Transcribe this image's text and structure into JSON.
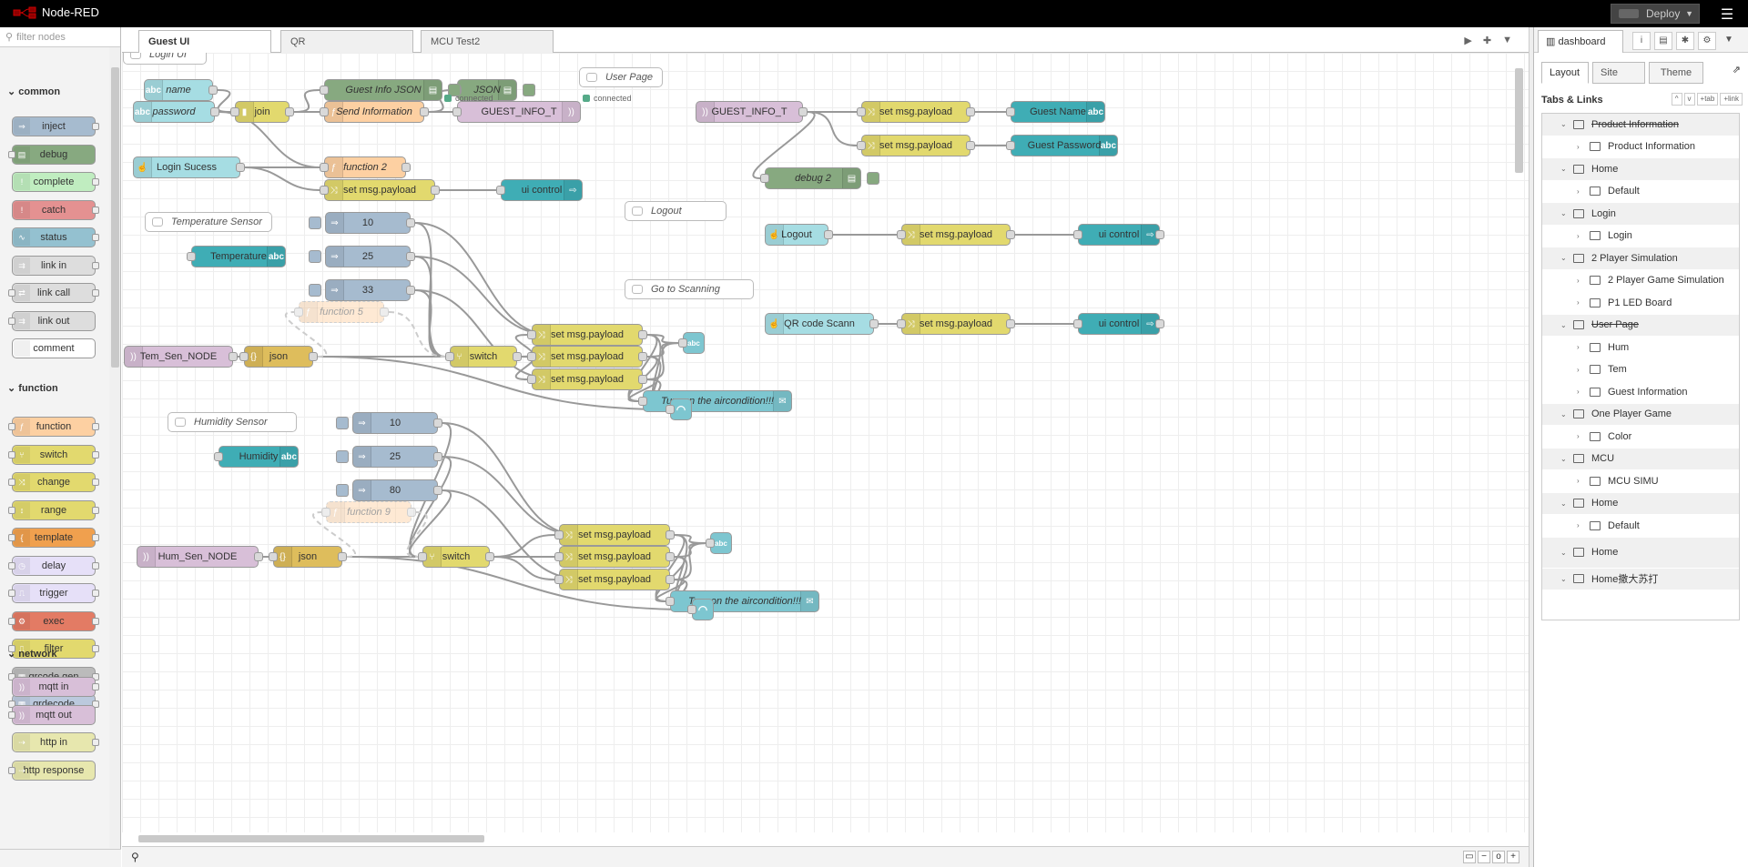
{
  "app": {
    "title": "Node-RED",
    "deploy": "Deploy",
    "menu_icon": "hamburger-icon"
  },
  "palette": {
    "filter_placeholder": "filter nodes",
    "categories": [
      {
        "name": "common",
        "nodes": [
          "inject",
          "debug",
          "complete",
          "catch",
          "status",
          "link in",
          "link call",
          "link out",
          "comment"
        ]
      },
      {
        "name": "function",
        "nodes": [
          "function",
          "switch",
          "change",
          "range",
          "template",
          "delay",
          "trigger",
          "exec",
          "filter",
          "qrcode gen",
          "qrdecode"
        ]
      },
      {
        "name": "network",
        "nodes": [
          "mqtt in",
          "mqtt out",
          "http in",
          "http response"
        ]
      }
    ]
  },
  "workspace": {
    "tabs": [
      "Guest UI",
      "QR",
      "MCU Test2"
    ],
    "active_tab": "Guest UI",
    "comments": [
      "Login UI",
      "User Page",
      "Temperature Sensor",
      "Logout",
      "Go to Scanning",
      "Humidity Sensor"
    ],
    "nodes": {
      "name": "name",
      "password": "password",
      "join": "join",
      "guest_info_json": "Guest Info JSON",
      "json_debug": "JSON",
      "send_information": "Send Information",
      "guest_info_t_out": "GUEST_INFO_T",
      "guest_info_t_in": "GUEST_INFO_T",
      "set1": "set msg.payload",
      "set2": "set msg.payload",
      "guest_name": "Guest Name",
      "guest_password": "Guest Password",
      "debug2": "debug 2",
      "login_sucess": "Login Sucess",
      "function2": "function 2",
      "set_login": "set msg.payload",
      "ui_control1": "ui control",
      "logout": "Logout",
      "set_logout": "set msg.payload",
      "ui_control2": "ui control",
      "qr_scann": "QR code Scann",
      "set_qr": "set msg.payload",
      "ui_control3": "ui control",
      "temperature": "Temperature",
      "inj10": "10",
      "inj25": "25",
      "inj33": "33",
      "function5": "function 5",
      "tem_sen_node": "Tem_Sen_NODE",
      "json1": "json",
      "switch1": "switch",
      "t_set1": "set msg.payload",
      "t_set2": "set msg.payload",
      "t_set3": "set msg.payload",
      "t_email": "Turn on the aircondition!!!",
      "humidity": "Humidity",
      "h_inj10": "10",
      "h_inj25": "25",
      "h_inj80": "80",
      "function9": "function 9",
      "hum_sen_node": "Hum_Sen_NODE",
      "json2": "json",
      "switch2": "switch",
      "h_set1": "set msg.payload",
      "h_set2": "set msg.payload",
      "h_set3": "set msg.payload",
      "h_email": "Turn on the aircondition!!!"
    },
    "status": {
      "connected": "connected"
    }
  },
  "sidebar": {
    "title": "dashboard",
    "tabs": [
      "Layout",
      "Site",
      "Theme"
    ],
    "active": "Layout",
    "section": "Tabs & Links",
    "tools": [
      "^",
      "v",
      "+tab",
      "+link"
    ],
    "tree": [
      {
        "label": "Product Information",
        "type": "tab",
        "strike": true
      },
      {
        "label": "Product Information",
        "type": "group"
      },
      {
        "label": "Home",
        "type": "tab"
      },
      {
        "label": "Default",
        "type": "group"
      },
      {
        "label": "Login",
        "type": "tab"
      },
      {
        "label": "Login",
        "type": "group"
      },
      {
        "label": "2 Player Simulation",
        "type": "tab"
      },
      {
        "label": "2 Player Game Simulation",
        "type": "group"
      },
      {
        "label": "P1 LED Board",
        "type": "group"
      },
      {
        "label": "User Page",
        "type": "tab",
        "strike": true
      },
      {
        "label": "Hum",
        "type": "group"
      },
      {
        "label": "Tem",
        "type": "group"
      },
      {
        "label": "Guest Information",
        "type": "group"
      },
      {
        "label": "One Player Game",
        "type": "tab"
      },
      {
        "label": "Color",
        "type": "group"
      },
      {
        "label": "MCU",
        "type": "tab"
      },
      {
        "label": "MCU SIMU",
        "type": "group"
      },
      {
        "label": "Home",
        "type": "tab"
      },
      {
        "label": "Default",
        "type": "group"
      },
      {
        "label": "Home",
        "type": "tab"
      },
      {
        "label": "Home撒大苏打",
        "type": "tab"
      }
    ]
  }
}
